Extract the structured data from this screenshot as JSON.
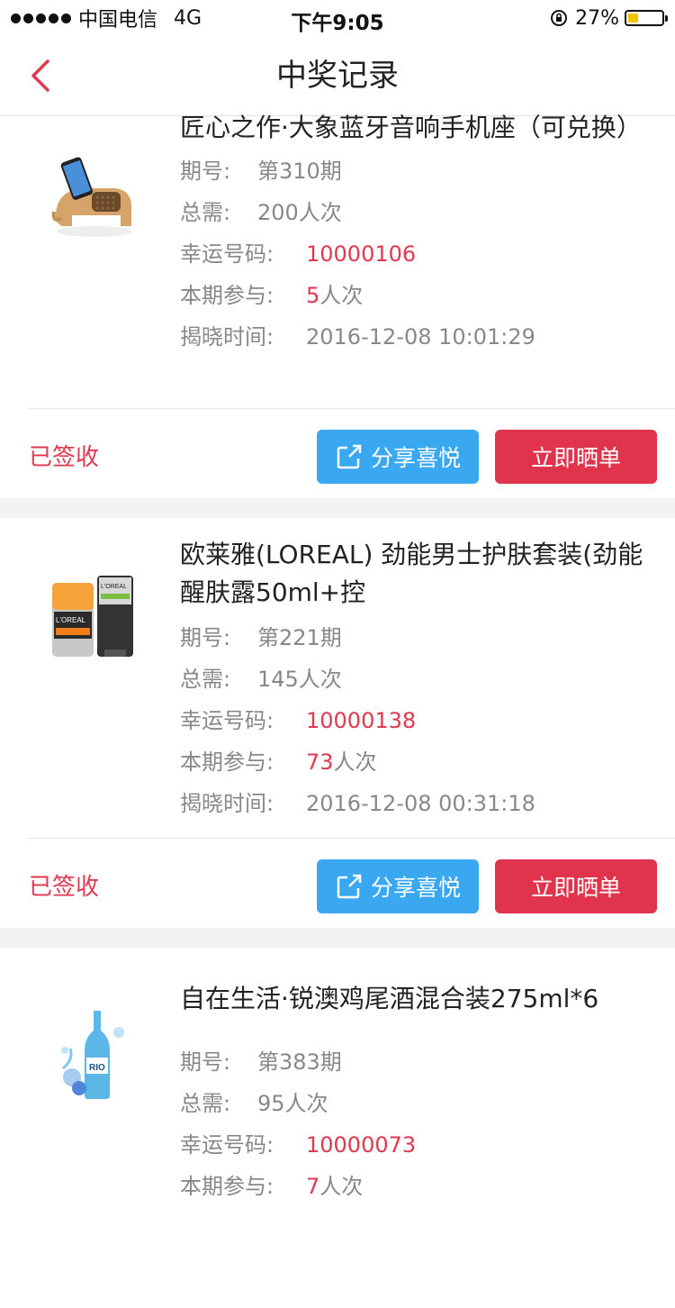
{
  "status_bar": {
    "carrier": "中国电信",
    "network": "4G",
    "time": "下午9:05",
    "battery": "27%",
    "battery_level": 0.27
  },
  "nav": {
    "title": "中奖记录"
  },
  "labels": {
    "period": "期号:",
    "total": "总需:",
    "lucky": "幸运号码:",
    "joined": "本期参与:",
    "reveal": "揭晓时间:",
    "joined_unit": "人次",
    "share_button": "分享喜悦",
    "show_button": "立即晒单"
  },
  "items": [
    {
      "title": "匠心之作·大象蓝牙音响手机座（可兑换）",
      "period": "第310期",
      "total": "200人次",
      "lucky_number": "10000106",
      "joined_count": "5",
      "reveal_time": "2016-12-08 10:01:29",
      "status": "已签收"
    },
    {
      "title": "欧莱雅(LOREAL) 劲能男士护肤套装(劲能醒肤露50ml+控",
      "period": "第221期",
      "total": "145人次",
      "lucky_number": "10000138",
      "joined_count": "73",
      "reveal_time": "2016-12-08 00:31:18",
      "status": "已签收"
    },
    {
      "title": "自在生活·锐澳鸡尾酒混合装275ml*6",
      "period": "第383期",
      "total": "95人次",
      "lucky_number": "10000073",
      "joined_count": "7"
    }
  ],
  "colors": {
    "accent_red": "#e03850",
    "share_blue": "#3aa8f0",
    "show_red": "#e0334c"
  }
}
